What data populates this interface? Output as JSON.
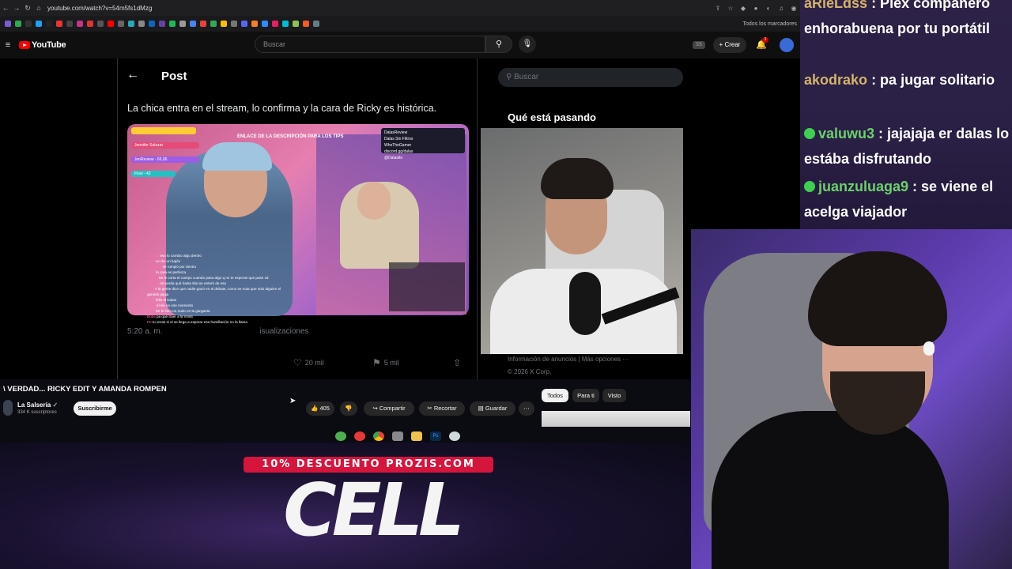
{
  "browser": {
    "url": "youtube.com/watch?v=54m5fs1dMzg",
    "bookmarks_folder": "Todos los marcadores"
  },
  "youtube": {
    "logo_text": "YouTube",
    "search_placeholder": "Buscar",
    "create_label": "Crear",
    "notifications_count": "1",
    "video_title": "\\ VERDAD... RICKY EDIT Y AMANDA ROMPEN",
    "channel_name": "La Salsería",
    "channel_subs": "334 K suscriptores",
    "subscribe_label": "Suscribirme",
    "likes": "405",
    "share_label": "Compartir",
    "clip_label": "Recortar",
    "save_label": "Guardar",
    "chips": [
      "Todos",
      "Para ti",
      "Visto"
    ]
  },
  "x_post": {
    "header": "Post",
    "text": "La chica entra en el stream, lo confirma y la cara de Ricky es histórica.",
    "time": "5:20 a. m.",
    "views_suffix": "isualizaciones",
    "likes": "20 mil",
    "bookmarks": "5 mil",
    "search_placeholder": "Buscar",
    "trending_title": "Qué está pasando",
    "footer_line1": "Información de anuncios   |   Más opciones ···",
    "footer_line2": "© 2026 X Corp.",
    "media_banner": "ENLACE DE LA DESCRIPCIÓN PARA LOS TIPS",
    "media_social": [
      "DalasReview",
      "Dalas Sin Filtros",
      "WhoTheGamer",
      "discord.gg/dalas",
      "@Dalasito"
    ],
    "media_hud": [
      "Jennifer Salazar",
      "JenReview - 66,06",
      "Flow - 43"
    ],
    "overlay_chat": [
      {
        "user": "Marcos",
        "text": "eso lo cambio algo dentro"
      },
      {
        "user": "Agm",
        "text": "Le dio un bajón"
      },
      {
        "user": "Snowsky",
        "text": "se rompió por dentro"
      },
      {
        "user": "Ialen",
        "text": "la cara es perfecta"
      },
      {
        "user": "Carlos",
        "text": "Se le corta el cuerpo cuando pasa algo q no te esperas que pase xd"
      },
      {
        "user": "Marcos",
        "text": "recuerda qué hasta Ibai se enteró de eso"
      },
      {
        "user": "Luis",
        "text": "Y la gente dice que nadie ganó en el debate, como se nota que solo alguien el ganado jajaja"
      },
      {
        "user": "Anto",
        "text": "folio el Dalas"
      },
      {
        "user": "Sean",
        "text": "el riki en ese momento"
      },
      {
        "user": "Agm",
        "text": "Se le hizo un nudo en la garganta"
      },
      {
        "user": "Boba",
        "text": "pa qué traer a la novia"
      },
      {
        "user": "Pe",
        "text": "tu veras si el se llega a esperar esa humillación no la llama"
      }
    ]
  },
  "stream_chat": [
    {
      "user": "aRieLdss",
      "text": ": Plex compañero enhorabuena por tu portátil",
      "badge": false
    },
    {
      "user": "akodrako",
      "text": ": pa jugar solitario",
      "badge": false
    },
    {
      "user": "valuwu3",
      "text": ": jajajaja er dalas lo estába disfrutando",
      "badge": true
    },
    {
      "user": "juanzuluaga9",
      "text": ": se viene el acelga viajador",
      "badge": true
    }
  ],
  "promo": {
    "banner": "10% DESCUENTO PROZIS.COM",
    "big": "CELL"
  },
  "colors": {
    "yt_red": "#ff0000",
    "promo_red": "#d6153c",
    "chat_user_gold": "#d4b26a",
    "chat_user_green": "#6cd06c"
  }
}
